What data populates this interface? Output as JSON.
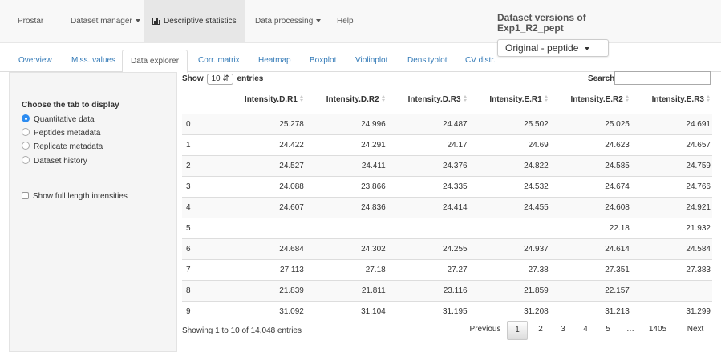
{
  "navbar": {
    "brand": "Prostar",
    "dataset_manager": "Dataset manager",
    "descriptive_statistics": "Descriptive statistics",
    "data_processing": "Data processing",
    "help": "Help"
  },
  "versions": {
    "title": "Dataset versions of Exp1_R2_pept",
    "selected": "Original - peptide"
  },
  "tabs": [
    "Overview",
    "Miss. values",
    "Data explorer",
    "Corr. matrix",
    "Heatmap",
    "Boxplot",
    "Violinplot",
    "Densityplot",
    "CV distr."
  ],
  "sidebar": {
    "heading": "Choose the tab to display",
    "options": [
      "Quantitative data",
      "Peptides metadata",
      "Replicate metadata",
      "Dataset history"
    ],
    "selected_index": 0,
    "checkbox_label": "Show full length intensities"
  },
  "table_controls": {
    "show_label": "Show",
    "entries_value": "10",
    "entries_label": "entries",
    "search_label": "Search:",
    "search_value": ""
  },
  "table": {
    "columns": [
      "",
      "Intensity.D.R1",
      "Intensity.D.R2",
      "Intensity.D.R3",
      "Intensity.E.R1",
      "Intensity.E.R2",
      "Intensity.E.R3"
    ],
    "rows": [
      [
        "0",
        "25.278",
        "24.996",
        "24.487",
        "25.502",
        "25.025",
        "24.691"
      ],
      [
        "1",
        "24.422",
        "24.291",
        "24.17",
        "24.69",
        "24.623",
        "24.657"
      ],
      [
        "2",
        "24.527",
        "24.411",
        "24.376",
        "24.822",
        "24.585",
        "24.759"
      ],
      [
        "3",
        "24.088",
        "23.866",
        "24.335",
        "24.532",
        "24.674",
        "24.766"
      ],
      [
        "4",
        "24.607",
        "24.836",
        "24.414",
        "24.455",
        "24.608",
        "24.921"
      ],
      [
        "5",
        "",
        "",
        "",
        "",
        "22.18",
        "21.932"
      ],
      [
        "6",
        "24.684",
        "24.302",
        "24.255",
        "24.937",
        "24.614",
        "24.584"
      ],
      [
        "7",
        "27.113",
        "27.18",
        "27.27",
        "27.38",
        "27.351",
        "27.383"
      ],
      [
        "8",
        "21.839",
        "21.811",
        "23.116",
        "21.859",
        "22.157",
        ""
      ],
      [
        "9",
        "31.092",
        "31.104",
        "31.195",
        "31.208",
        "31.213",
        "31.299"
      ]
    ]
  },
  "footer": {
    "info": "Showing 1 to 10 of 14,048 entries",
    "previous": "Previous",
    "pages": [
      "1",
      "2",
      "3",
      "4",
      "5",
      "…",
      "1405"
    ],
    "current_page": "1",
    "next": "Next"
  }
}
